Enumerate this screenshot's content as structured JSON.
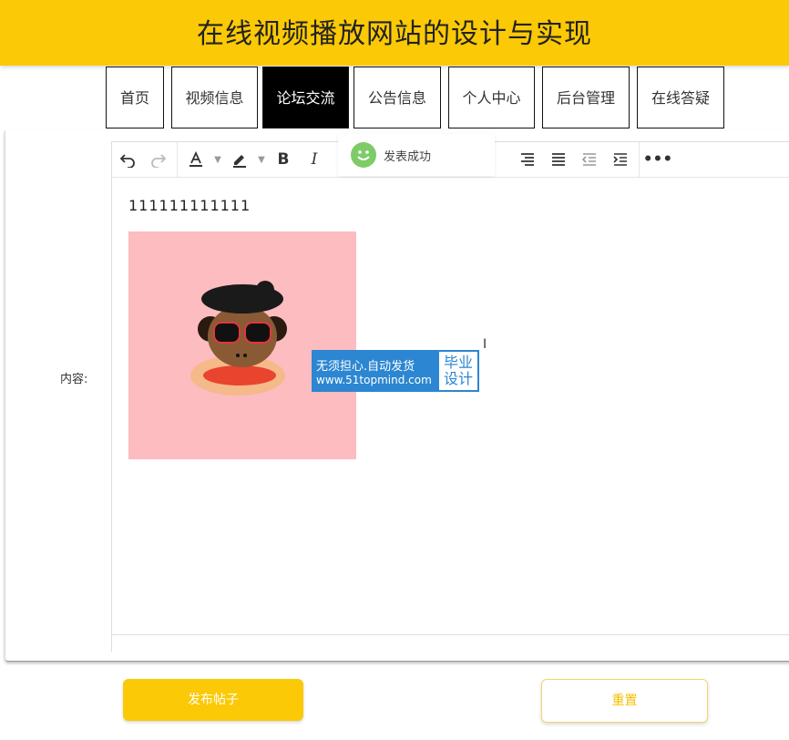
{
  "header": {
    "title": "在线视频播放网站的设计与实现"
  },
  "nav": {
    "items": [
      {
        "label": "首页"
      },
      {
        "label": "视频信息"
      },
      {
        "label": "论坛交流",
        "active": true
      },
      {
        "label": "公告信息"
      },
      {
        "label": "个人中心"
      },
      {
        "label": "后台管理"
      },
      {
        "label": "在线答疑"
      }
    ]
  },
  "form": {
    "content_label": "内容:",
    "editor": {
      "text": "111111111111",
      "toast": "发表成功",
      "toolbar_icons": [
        "undo-icon",
        "redo-icon",
        "font-color-icon",
        "highlight-icon",
        "bold-icon",
        "italic-icon",
        "align-right-icon",
        "justify-icon",
        "outdent-icon",
        "indent-icon",
        "more-icon"
      ]
    },
    "watermark": {
      "line1": "无须担心.自动发货",
      "line2": "www.51topmind.com",
      "badge_line1": "毕业",
      "badge_line2": "设计"
    },
    "submit_label": "发布帖子",
    "reset_label": "重置"
  },
  "colors": {
    "brand": "#fbc905",
    "nav_active": "#000000",
    "image_bg": "#fdbcbf",
    "watermark": "#2c86d1"
  }
}
